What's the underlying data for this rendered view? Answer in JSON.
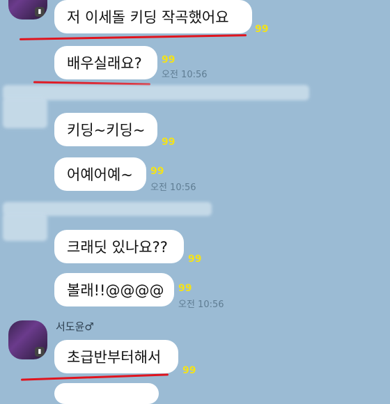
{
  "colors": {
    "background": "#9bbbd4",
    "bubble": "#ffffff",
    "unread": "#f3e21a",
    "redline": "#e0141e"
  },
  "messages": [
    {
      "text": "저 이세돌 키딩 작곡했어요",
      "unread": "99"
    },
    {
      "text": "배우실래요?",
      "unread": "99",
      "time": "오전 10:56"
    },
    {
      "text": "키딩~키딩~",
      "unread": "99"
    },
    {
      "text": "어예어예~",
      "unread": "99",
      "time": "오전 10:56"
    },
    {
      "text": "크래딧 있나요??",
      "unread": "99"
    },
    {
      "text": "볼래!!@@@@",
      "unread": "99",
      "time": "오전 10:56"
    },
    {
      "text": "초급반부터해서",
      "unread": "99"
    }
  ],
  "sender": {
    "name": "서도윤♂"
  }
}
